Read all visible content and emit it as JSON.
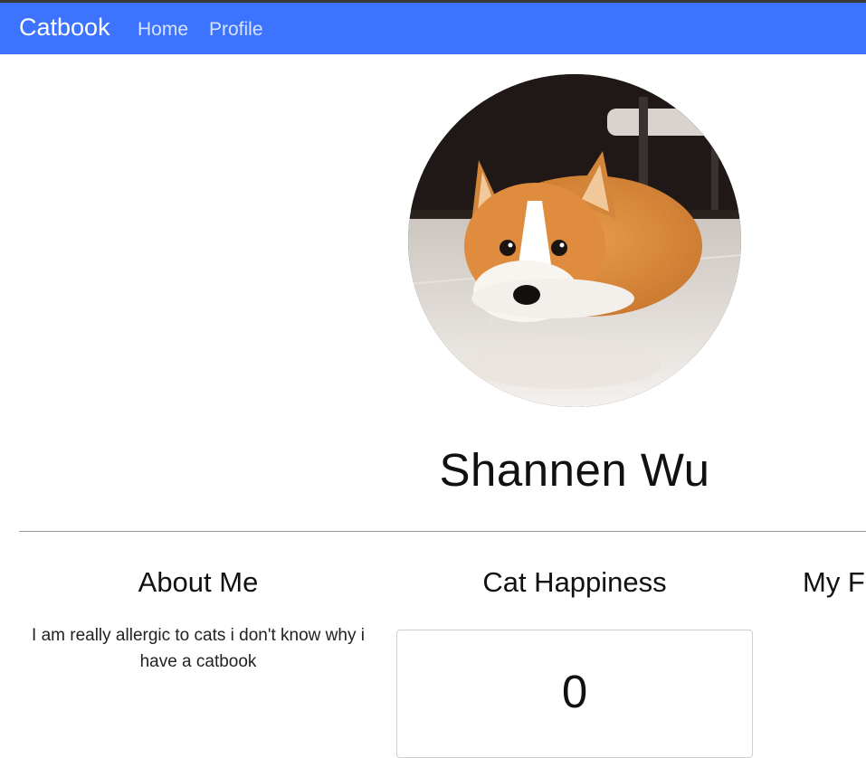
{
  "navbar": {
    "brand": "Catbook",
    "links": [
      "Home",
      "Profile"
    ],
    "background": "#3c74ff"
  },
  "profile": {
    "avatar_icon": "corgi-photo",
    "name": "Shannen Wu"
  },
  "sections": {
    "about": {
      "title": "About Me",
      "text": "I am really allergic to cats i don't know why i have a catbook"
    },
    "happiness": {
      "title": "Cat Happiness",
      "value": "0"
    },
    "favorite": {
      "title": "My Fa"
    }
  }
}
